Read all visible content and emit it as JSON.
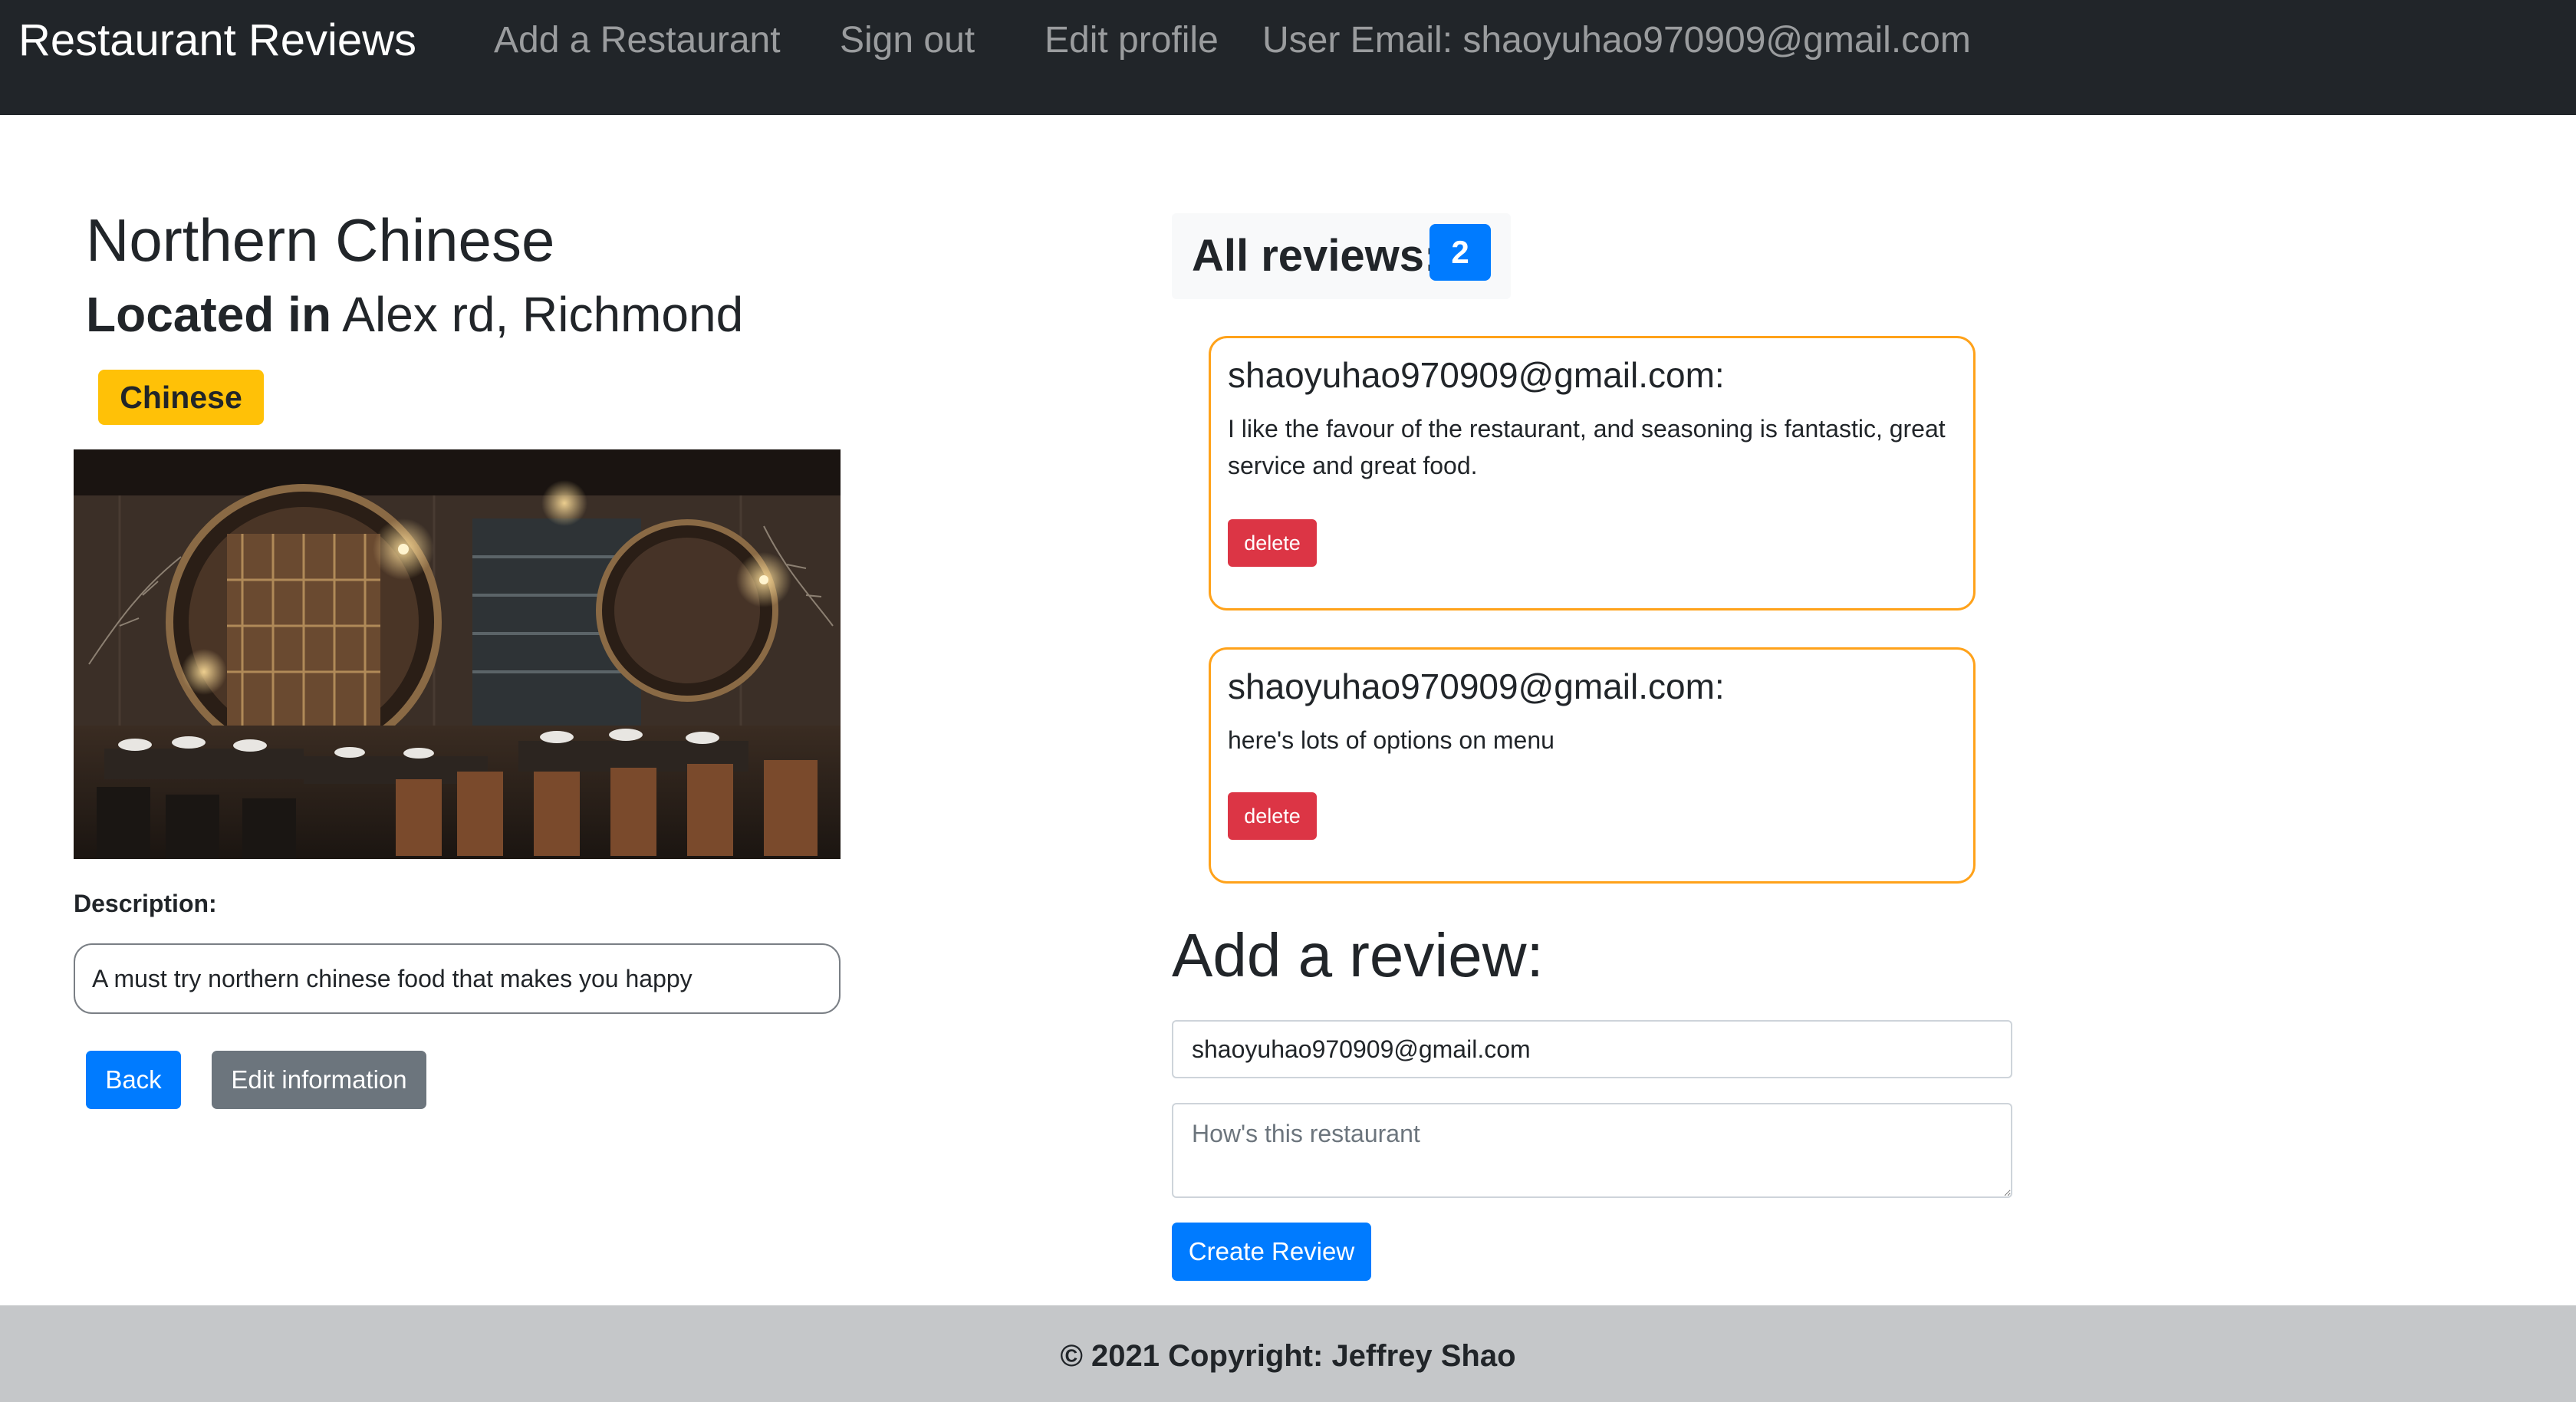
{
  "navbar": {
    "brand": "Restaurant Reviews",
    "add_restaurant": "Add a Restaurant",
    "sign_out": "Sign out",
    "edit_profile": "Edit profile",
    "user_email": "User Email: shaoyuhao970909@gmail.com"
  },
  "restaurant": {
    "name": "Northern Chinese",
    "located_prefix": "Located in",
    "location": "Alex rd, Richmond",
    "cuisine": "Chinese",
    "description_label": "Description:",
    "description": "A must try northern chinese food that makes you happy"
  },
  "actions": {
    "back": "Back",
    "edit_information": "Edit information"
  },
  "reviews": {
    "header": "All reviews:",
    "count": "2",
    "items": [
      {
        "author": "shaoyuhao970909@gmail.com:",
        "text": "I like the favour of the restaurant, and seasoning is fantastic, great service and great food.",
        "delete_label": "delete"
      },
      {
        "author": "shaoyuhao970909@gmail.com:",
        "text": "here's lots of options on menu",
        "delete_label": "delete"
      }
    ]
  },
  "add_review": {
    "title": "Add a review:",
    "email_value": "shaoyuhao970909@gmail.com",
    "review_placeholder": "How's this restaurant",
    "submit": "Create Review"
  },
  "footer": {
    "copyright": "© 2021 Copyright: Jeffrey Shao"
  },
  "colors": {
    "navbar_bg": "#212529",
    "primary": "#007bff",
    "secondary": "#6c757d",
    "danger": "#dc3545",
    "warning": "#ffc107",
    "card_border": "#ffa21a",
    "footer_bg": "#c5c7c9"
  }
}
